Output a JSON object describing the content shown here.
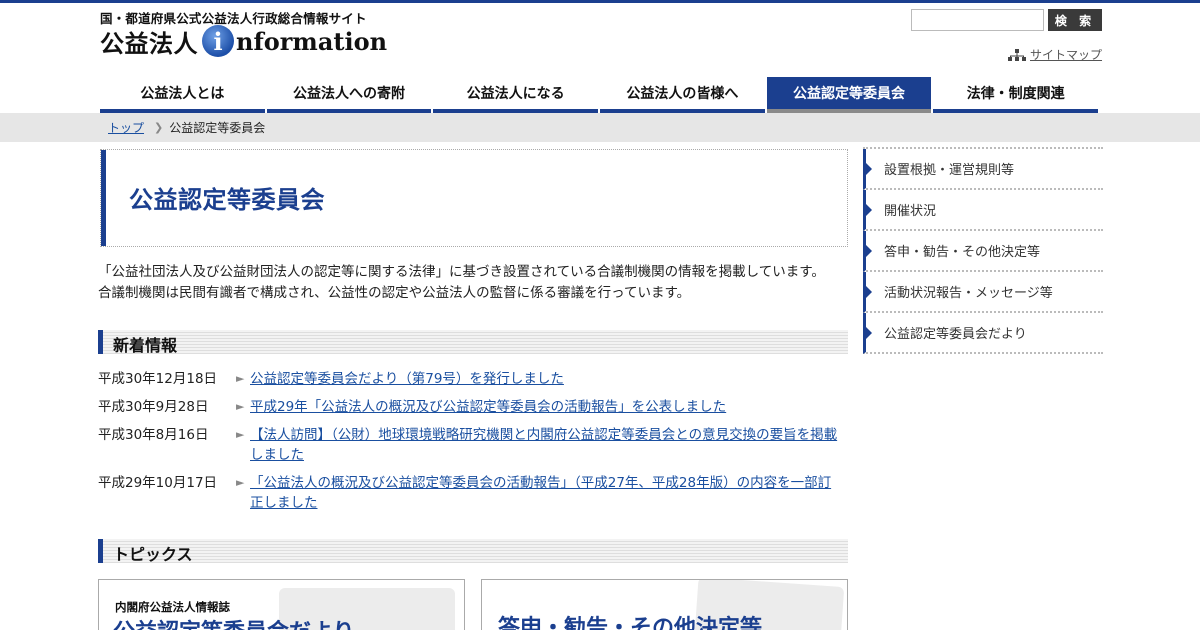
{
  "header": {
    "site_subtitle": "国・都道府県公式公益法人行政総合情報サイト",
    "logo_jp": "公益法人",
    "logo_i": "i",
    "logo_en": "nformation",
    "search_placeholder": "",
    "search_button": "検 索",
    "sitemap_label": "サイトマップ"
  },
  "nav": {
    "items": [
      {
        "label": "公益法人とは"
      },
      {
        "label": "公益法人への寄附"
      },
      {
        "label": "公益法人になる"
      },
      {
        "label": "公益法人の皆様へ"
      },
      {
        "label": "公益認定等委員会"
      },
      {
        "label": "法律・制度関連"
      }
    ],
    "active_index": 4
  },
  "breadcrumb": {
    "home": "トップ",
    "current": "公益認定等委員会"
  },
  "main": {
    "title": "公益認定等委員会",
    "lead": "「公益社団法人及び公益財団法人の認定等に関する法律」に基づき設置されている合議制機関の情報を掲載しています。合議制機関は民間有識者で構成され、公益性の認定や公益法人の監督に係る審議を行っています。",
    "news_heading": "新着情報",
    "news": [
      {
        "date": "平成30年12月18日",
        "text": "公益認定等委員会だより（第79号）を発行しました"
      },
      {
        "date": "平成30年9月28日",
        "text": "平成29年「公益法人の概況及び公益認定等委員会の活動報告」を公表しました"
      },
      {
        "date": "平成30年8月16日",
        "text": "【法人訪問】（公財）地球環境戦略研究機関と内閣府公益認定等委員会との意見交換の要旨を掲載しました"
      },
      {
        "date": "平成29年10月17日",
        "text": "「公益法人の概況及び公益認定等委員会の活動報告」（平成27年、平成28年版）の内容を一部訂正しました"
      }
    ],
    "topics_heading": "トピックス",
    "topic_cards": [
      {
        "sub": "内閣府公益法人情報誌",
        "main": "公益認定等委員会だより"
      },
      {
        "main": "答申・勧告・その他決定等"
      }
    ]
  },
  "side": {
    "items": [
      {
        "label": "設置根拠・運営規則等"
      },
      {
        "label": "開催状況"
      },
      {
        "label": "答申・勧告・その他決定等"
      },
      {
        "label": "活動状況報告・メッセージ等"
      },
      {
        "label": "公益認定等委員会だより"
      }
    ]
  },
  "colors": {
    "brand": "#1b3f8f",
    "link": "#1a4fa0",
    "crumb_bg": "#e6e6e6"
  }
}
